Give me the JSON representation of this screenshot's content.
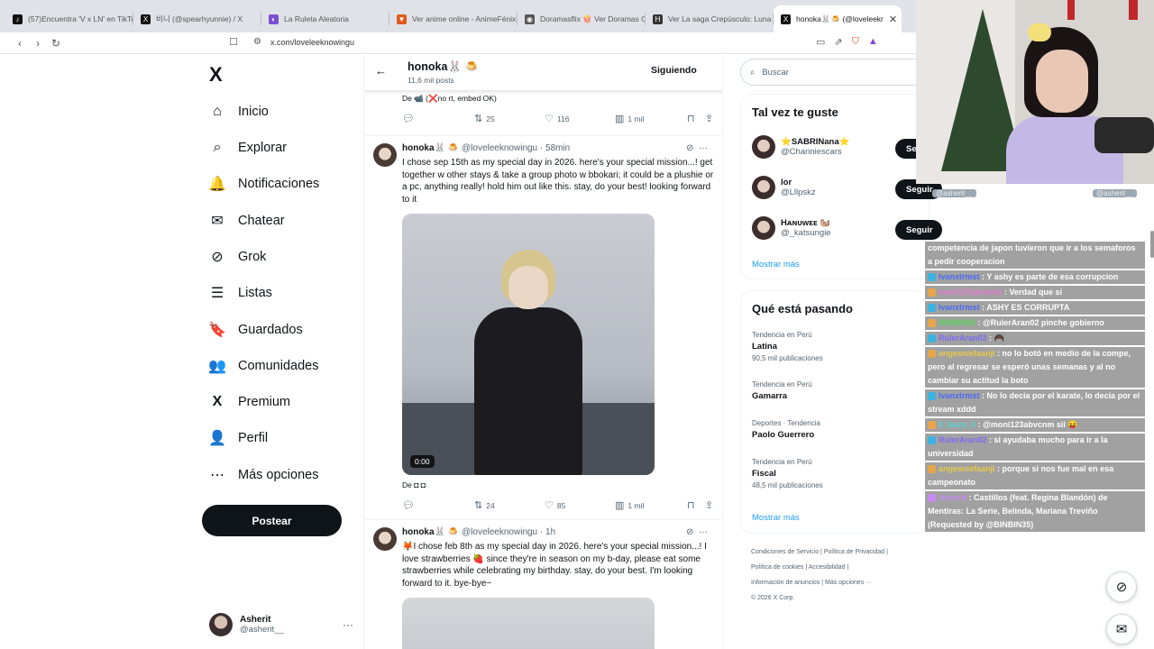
{
  "browser": {
    "tabs": [
      {
        "label": "(57)Encuentra 'V x LN' en TikTo",
        "icon": "tiktok-icon",
        "color": "#111111"
      },
      {
        "label": "비니 (@spearhyunnie) / X",
        "icon": "x-logo-icon",
        "color": "#111111"
      },
      {
        "label": "La Ruleta Aleatoria",
        "icon": "roulette-icon",
        "color": "#7b4fd1"
      },
      {
        "label": "Ver anime online - AnimeFénix",
        "icon": "anime-icon",
        "color": "#e05a1a"
      },
      {
        "label": "Doramasflix 🍿 Ver Doramas O",
        "icon": "doramas-icon",
        "color": "#555555"
      },
      {
        "label": "Ver La saga Crepúsculo: Luna N",
        "icon": "hd-icon",
        "color": "#333333"
      },
      {
        "label": "honoka🐰🍮 (@loveleekr",
        "icon": "x-logo-icon",
        "color": "#111111",
        "close": "✕"
      }
    ],
    "url": "x.com/loveleeknowingu"
  },
  "nav": {
    "logo": "X",
    "items": [
      {
        "label": "Inicio",
        "icon": "⌂"
      },
      {
        "label": "Explorar",
        "icon": "⌕"
      },
      {
        "label": "Notificaciones",
        "icon": "🔔"
      },
      {
        "label": "Chatear",
        "icon": "✉"
      },
      {
        "label": "Grok",
        "icon": "⊘"
      },
      {
        "label": "Listas",
        "icon": "☰"
      },
      {
        "label": "Guardados",
        "icon": "🔖"
      },
      {
        "label": "Comunidades",
        "icon": "👥"
      },
      {
        "label": "Premium",
        "icon": "X"
      },
      {
        "label": "Perfil",
        "icon": "👤"
      },
      {
        "label": "Más opciones",
        "icon": "⋯"
      }
    ],
    "post_label": "Postear",
    "user": {
      "name": "Asherit",
      "handle": "@asherit__",
      "more": "···"
    }
  },
  "timeline": {
    "name": "honoka🐰 🍮",
    "post_count": "11,6 mil posts",
    "follow_label": "Siguiendo",
    "prev_source": "De 📹 (❌no rt, embed OK)",
    "prev_actions": {
      "replies": "",
      "reposts": "25",
      "likes": "116",
      "views": "1 mil"
    },
    "tweet1": {
      "name": "honoka🐰 🍮",
      "handle": "@loveleeknowingu · 58min",
      "text": "I chose sep 15th as my special day in 2026. here's your special mission...! get together w other stays & take a group photo w bbokari; it could be a plushie or a pc, anything really! hold him out like this. stay, do your best! looking forward to it",
      "video_time": "0:00",
      "source": "De ◘ ◘",
      "actions": {
        "replies": "",
        "reposts": "24",
        "likes": "85",
        "views": "1 mil"
      }
    },
    "tweet2": {
      "name": "honoka🐰 🍮",
      "handle": "@loveleeknowingu · 1h",
      "text": "🦊I chose feb 8th as my special day in 2026. here's your special mission...! I love strawberries 🍓 since they're in season on my b-day, please eat some strawberries while celebrating my birthday. stay, do your best. I'm looking forward to it. bye-bye~"
    }
  },
  "sidebar": {
    "search_placeholder": "Buscar",
    "wtf_title": "Tal vez te guste",
    "wtf": [
      {
        "name": "⭐SABRINana⭐",
        "handle": "@Channiescars",
        "button": "Se"
      },
      {
        "name": "lor",
        "handle": "@Lllpskz",
        "button": "Seguir"
      },
      {
        "name": "Hᴀɴᴜᴡᴇᴇ 🐿️",
        "handle": "@_katsungie",
        "button": "Seguir"
      }
    ],
    "wtf_more": "Mostrar más",
    "trends_title": "Qué está pasando",
    "trends": [
      {
        "context": "Tendencia en Perú",
        "title": "Latina",
        "count": "90,5 mil publicaciones"
      },
      {
        "context": "Tendencia en Perú",
        "title": "Gamarra",
        "count": ""
      },
      {
        "context": "Deportes · Tendencia",
        "title": "Paolo Guerrero",
        "count": ""
      },
      {
        "context": "Tendencia en Perú",
        "title": "Fiscal",
        "count": "48,5 mil publicaciones"
      }
    ],
    "trends_more": "Mostrar más",
    "footer": [
      "Condiciones de Servicio",
      "Política de Privacidad",
      "Política de cookies",
      "Accesibilidad",
      "Información de anuncios",
      "Más opciones ···",
      "© 2026 X Corp."
    ]
  },
  "stream": {
    "tags": [
      "@asherit__",
      "@asherit__"
    ],
    "chat": [
      {
        "user": "",
        "text": "competencia de japon tuvieron que ir a los semaforos a pedir cooperacion",
        "color": "#ffffff",
        "badge": ""
      },
      {
        "user": "Ivanxtrmst",
        "text": ": Y ashy es parte de esa corrupcion",
        "color": "#4a6cf7",
        "badge": "#3bb3e0"
      },
      {
        "user": "moni123abvcnm",
        "text": ": Verdad que si",
        "color": "#e57bd3",
        "badge": "#e8a54b"
      },
      {
        "user": "Ivanxtrmst",
        "text": ": ASHY ES CORRUPTA",
        "color": "#4a6cf7",
        "badge": "#3bb3e0"
      },
      {
        "user": "BINBIN35",
        "text": ": @RulerAran02 pinche gobierno",
        "color": "#5ad15a",
        "badge": "#e8a54b"
      },
      {
        "user": "RulerAran02",
        "text": ": 🦱",
        "color": "#7a6cf7",
        "badge": "#3bb3e0"
      },
      {
        "user": "angesniefaanji",
        "text": ": no lo botó en medio de la compe, pero al regresar se esperó unas semanas y al no cambiar su actitud la boto",
        "color": "#e8c84b",
        "badge": "#e8a54b"
      },
      {
        "user": "Ivanxtrmst",
        "text": ": No lo decia por el karate, lo decia por el stream xddd",
        "color": "#4a6cf7",
        "badge": "#3bb3e0"
      },
      {
        "user": "0_kiara_0",
        "text": ": @moni123abvcnm sii 😝",
        "color": "#5ad1d1",
        "badge": "#e8a54b"
      },
      {
        "user": "RulerAran02",
        "text": ": si ayudaba mucho para ir a la universidad",
        "color": "#7a6cf7",
        "badge": "#3bb3e0"
      },
      {
        "user": "angesniefaanji",
        "text": ": porque si nos fue mal en esa campeonato",
        "color": "#e8c84b",
        "badge": "#e8a54b"
      },
      {
        "user": "Asherit",
        "text": ": Castillos (feat. Regina Blandón) de Mentiras: La Serie, Belinda, Mariana Treviño (Requested by @BINBIN35)",
        "color": "#c88bf5",
        "badge": "#c88bf5"
      }
    ]
  },
  "fabs": {
    "grok": "⊘",
    "messages": "✉"
  }
}
